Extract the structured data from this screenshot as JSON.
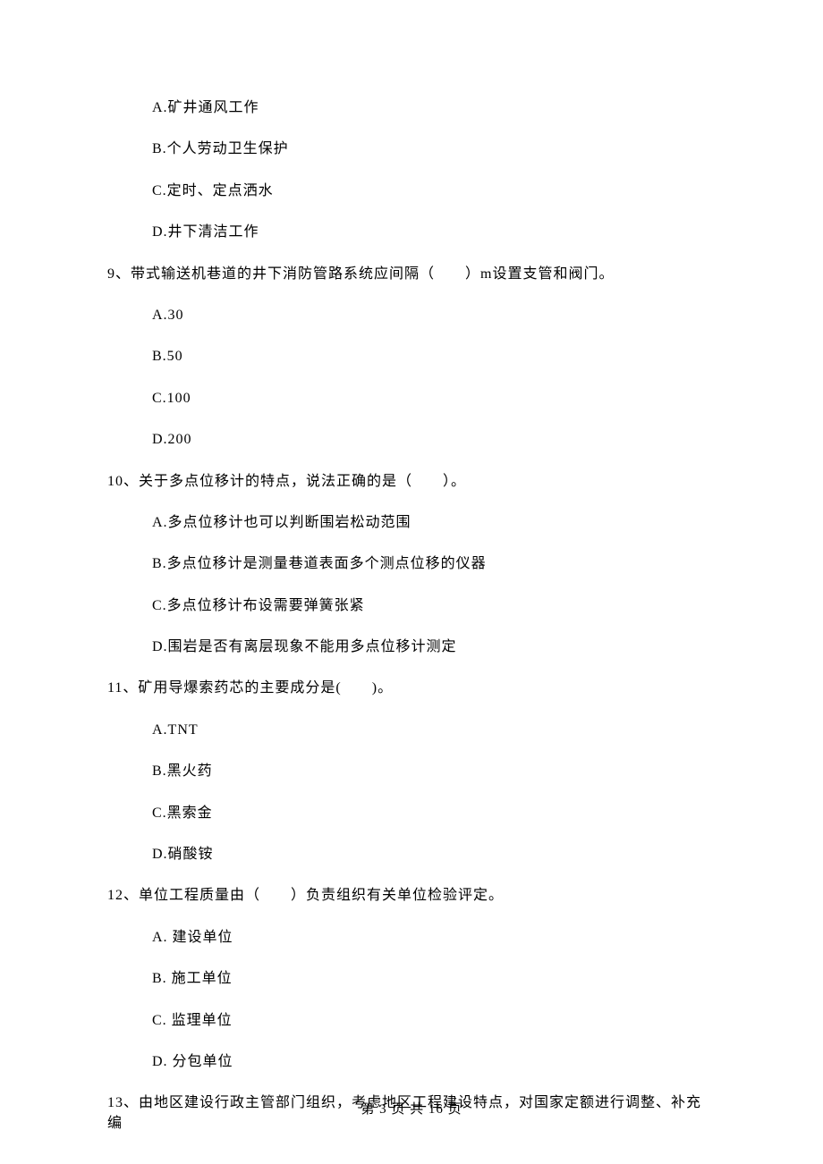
{
  "q8": {
    "options": {
      "A": "A.矿井通风工作",
      "B": "B.个人劳动卫生保护",
      "C": "C.定时、定点洒水",
      "D": "D.井下清洁工作"
    }
  },
  "q9": {
    "stem": "9、带式输送机巷道的井下消防管路系统应间隔（　　）m设置支管和阀门。",
    "options": {
      "A": "A.30",
      "B": "B.50",
      "C": "C.100",
      "D": "D.200"
    }
  },
  "q10": {
    "stem": "10、关于多点位移计的特点，说法正确的是（　　）。",
    "options": {
      "A": "A.多点位移计也可以判断围岩松动范围",
      "B": "B.多点位移计是测量巷道表面多个测点位移的仪器",
      "C": "C.多点位移计布设需要弹簧张紧",
      "D": "D.围岩是否有离层现象不能用多点位移计测定"
    }
  },
  "q11": {
    "stem": "11、矿用导爆索药芯的主要成分是(　　)。",
    "options": {
      "A": "A.TNT",
      "B": "B.黑火药",
      "C": "C.黑索金",
      "D": "D.硝酸铵"
    }
  },
  "q12": {
    "stem": "12、单位工程质量由（　　）负责组织有关单位检验评定。",
    "options": {
      "A": "A. 建设单位",
      "B": "B. 施工单位",
      "C": "C. 监理单位",
      "D": "D. 分包单位"
    }
  },
  "q13": {
    "stem": "13、由地区建设行政主管部门组织，考虑地区工程建设特点，对国家定额进行调整、补充编"
  },
  "footer": "第 3 页 共 16 页"
}
